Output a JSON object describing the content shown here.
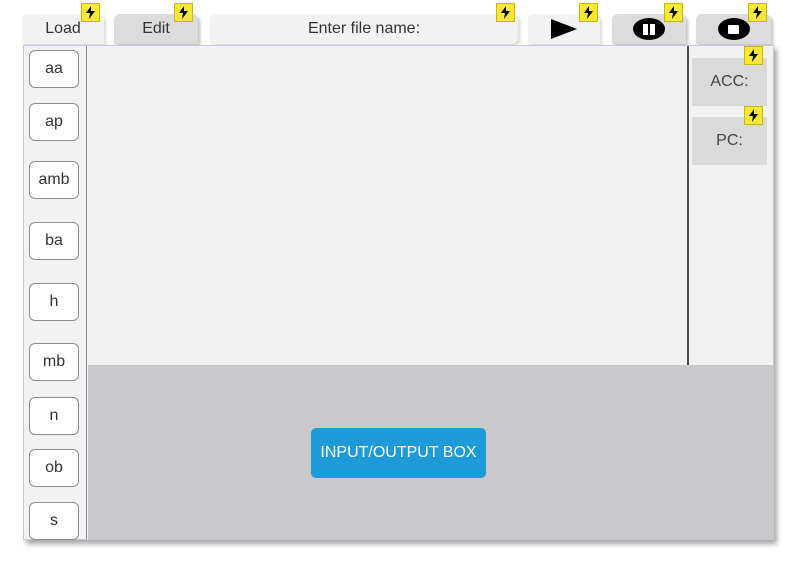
{
  "toolbar": {
    "load_label": "Load",
    "edit_label": "Edit",
    "filename_label": "Enter file name:",
    "play_icon": "play-icon",
    "pause_icon": "pause-icon",
    "stop_icon": "stop-icon",
    "event_icon": "lightning-icon"
  },
  "registers": {
    "buttons": [
      "aa",
      "ap",
      "amb",
      "ba",
      "h",
      "mb",
      "n",
      "ob",
      "s"
    ],
    "acc_label": "ACC:",
    "pc_label": "PC:"
  },
  "io": {
    "button_label": "INPUT/OUTPUT BOX"
  },
  "colors": {
    "accent": "#1e9ad8",
    "event_badge": "#f9e735",
    "io_background": "#c9c9cb",
    "panel_background": "#f2f2f2"
  }
}
